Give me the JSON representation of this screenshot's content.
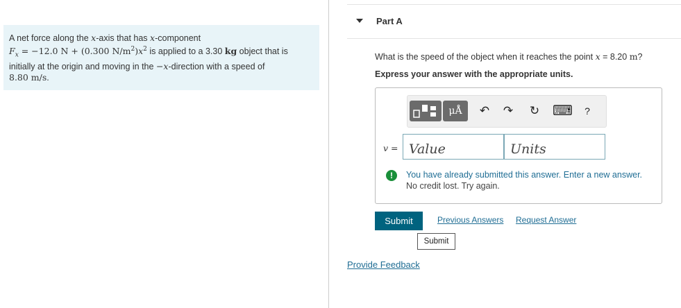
{
  "problem": {
    "intro": "A net force along the ",
    "axis_var": "x",
    "after_axis": "-axis that has ",
    "component_var": "x",
    "after_component": "-component",
    "force_lhs": "F",
    "force_sub": "x",
    "force_eq": " = −12.0 N + (0.300 N/m",
    "force_exp": "2",
    "force_close": ")",
    "force_x": "x",
    "force_x_exp": "2",
    "applied_text": " is applied to a 3.30 ",
    "mass_unit": "kg",
    "object_text": " object that is",
    "line3_a": "initially at the origin and moving in the ",
    "direction": "−x",
    "line3_b": "-direction with a speed of",
    "speed": "8.80 m/s",
    "speed_end": "."
  },
  "part": {
    "label": "Part A"
  },
  "question": {
    "text_a": "What is the speed of the object when it reaches the point ",
    "var": "x",
    "text_b": " = 8.20 ",
    "unit": "m",
    "text_c": "?"
  },
  "instruction": "Express your answer with the appropriate units.",
  "toolbar": {
    "unit_label": "μÅ",
    "undo_icon": "↶",
    "redo_icon": "↷",
    "reset_icon": "↻",
    "keyboard_icon": "⌨",
    "help_label": "?"
  },
  "answer": {
    "var_label": "v =",
    "value_placeholder": "Value",
    "units_placeholder": "Units"
  },
  "feedback": {
    "icon": "!",
    "line1": "You have already submitted this answer. Enter a new answer.",
    "line2": "No credit lost. Try again.",
    "icon_color": "#1a8f3a"
  },
  "actions": {
    "submit": "Submit",
    "previous_answers": "Previous Answers",
    "request_answer": "Request Answer",
    "tooltip": "Submit",
    "provide_feedback": "Provide Feedback"
  },
  "colors": {
    "primary": "#00637f",
    "link": "#1f6d94",
    "problem_bg": "#e8f4f8"
  }
}
